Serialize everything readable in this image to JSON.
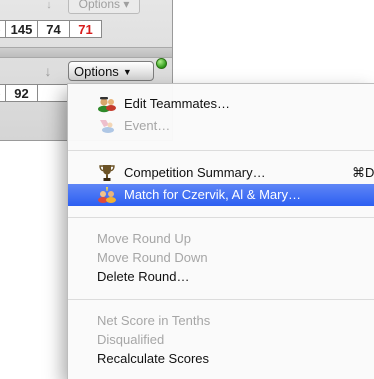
{
  "top_row": {
    "arrow": "↓",
    "options_label": "Options ▾"
  },
  "score_row_1": {
    "edge": ")",
    "values": [
      "145",
      "74",
      "71"
    ]
  },
  "toolbar": {
    "down_arrow": "↓",
    "options_label": "Options",
    "options_chevron": "▼",
    "status_color": "#2f9a1a"
  },
  "score_row_2": {
    "edge": ")",
    "values": [
      "92",
      ""
    ]
  },
  "menu": {
    "items": [
      {
        "label": "Edit Teammates…",
        "icon": "teammates-icon",
        "enabled": true
      },
      {
        "label": "Event…",
        "icon": "event-icon",
        "enabled": false
      },
      {
        "label": "Competition Summary…",
        "icon": "trophy-icon",
        "enabled": true,
        "shortcut": "⌘D"
      },
      {
        "label": "Match for Czervik, Al & Mary…",
        "icon": "match-icon",
        "enabled": true,
        "highlighted": true
      },
      {
        "label": "Move Round Up",
        "enabled": false
      },
      {
        "label": "Move Round Down",
        "enabled": false
      },
      {
        "label": "Delete Round…",
        "enabled": true
      },
      {
        "label": "Net Score in Tenths",
        "enabled": false
      },
      {
        "label": "Disqualified",
        "enabled": false
      },
      {
        "label": "Recalculate Scores",
        "enabled": true
      }
    ],
    "highlight_color": "#2c5ff1"
  }
}
